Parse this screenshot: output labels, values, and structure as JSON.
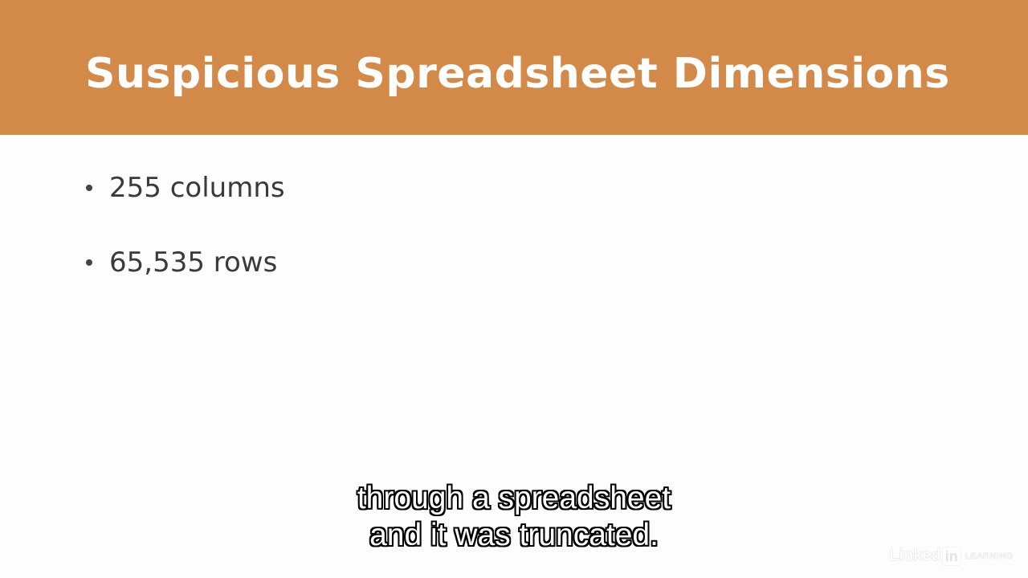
{
  "slide": {
    "title": "Suspicious Spreadsheet Dimensions",
    "bullets": [
      {
        "text": "255 columns"
      },
      {
        "text": "65,535 rows"
      }
    ]
  },
  "captions": {
    "lines": [
      "through a spreadsheet",
      "and it was truncated."
    ]
  },
  "watermark": {
    "linked": "Linked",
    "in": "in",
    "learning": "LEARNING"
  },
  "colors": {
    "title_band": "#d38a48",
    "title_text": "#ffffff",
    "body_text": "#3a3a3a",
    "background": "#fdfdfd"
  }
}
